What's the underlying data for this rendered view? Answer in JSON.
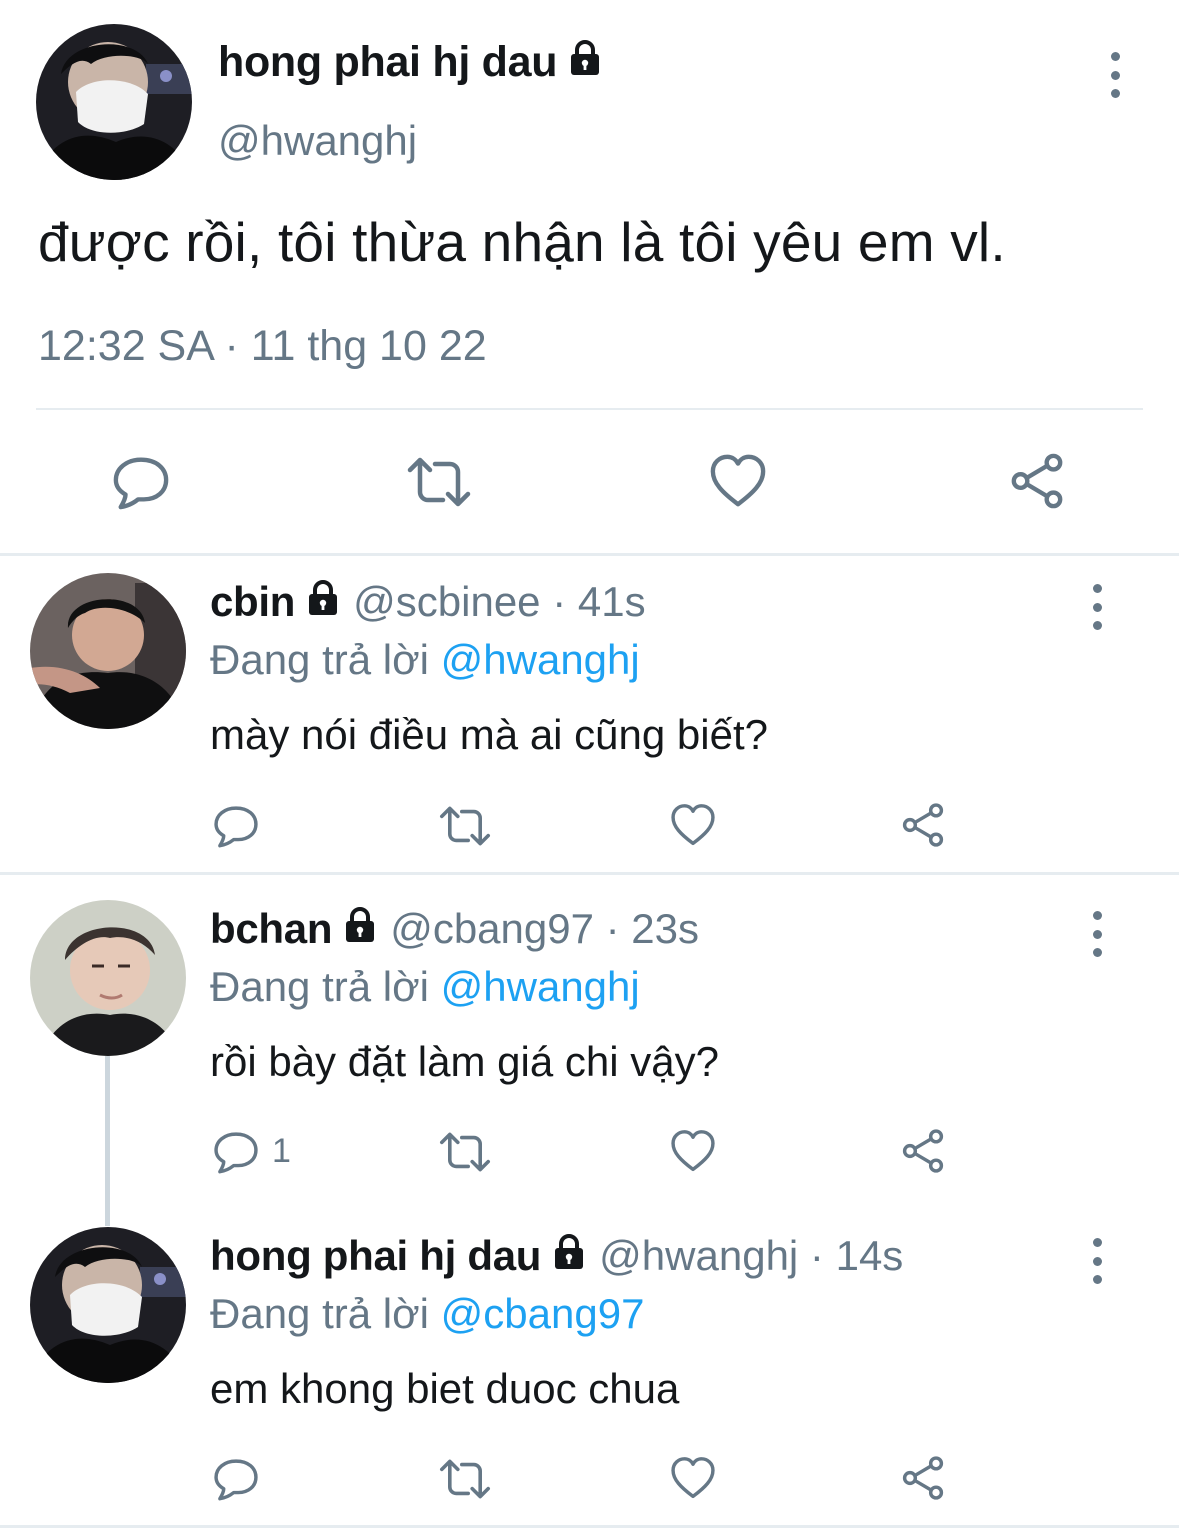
{
  "main_tweet": {
    "author_name": "hong phai hj dau",
    "handle": "@hwanghj",
    "text": "được rồi, tôi thừa nhận là tôi yêu em vl.",
    "timestamp": "12:32 SA · 11 thg 10 22"
  },
  "replies": [
    {
      "author_name": "cbin",
      "meta": "@scbinee · 41s",
      "reply_prefix": "Đang trả lời",
      "reply_to": "@hwanghj",
      "text": "mày nói điều mà ai cũng biết?",
      "reply_count": ""
    },
    {
      "author_name": "bchan",
      "meta": "@cbang97 · 23s",
      "reply_prefix": "Đang trả lời",
      "reply_to": "@hwanghj",
      "text": "rồi bày đặt làm giá chi vậy?",
      "reply_count": "1"
    },
    {
      "author_name": "hong phai hj dau",
      "meta": "@hwanghj · 14s",
      "reply_prefix": "Đang trả lời",
      "reply_to": "@cbang97",
      "text": "em khong biet duoc chua",
      "reply_count": ""
    }
  ],
  "colors": {
    "primary_text": "#14171a",
    "secondary_text": "#657786",
    "mention": "#1da1f2",
    "divider": "#e6ecf0"
  },
  "icons": [
    "lock-icon",
    "more-icon",
    "reply-icon",
    "retweet-icon",
    "like-icon",
    "share-icon"
  ]
}
